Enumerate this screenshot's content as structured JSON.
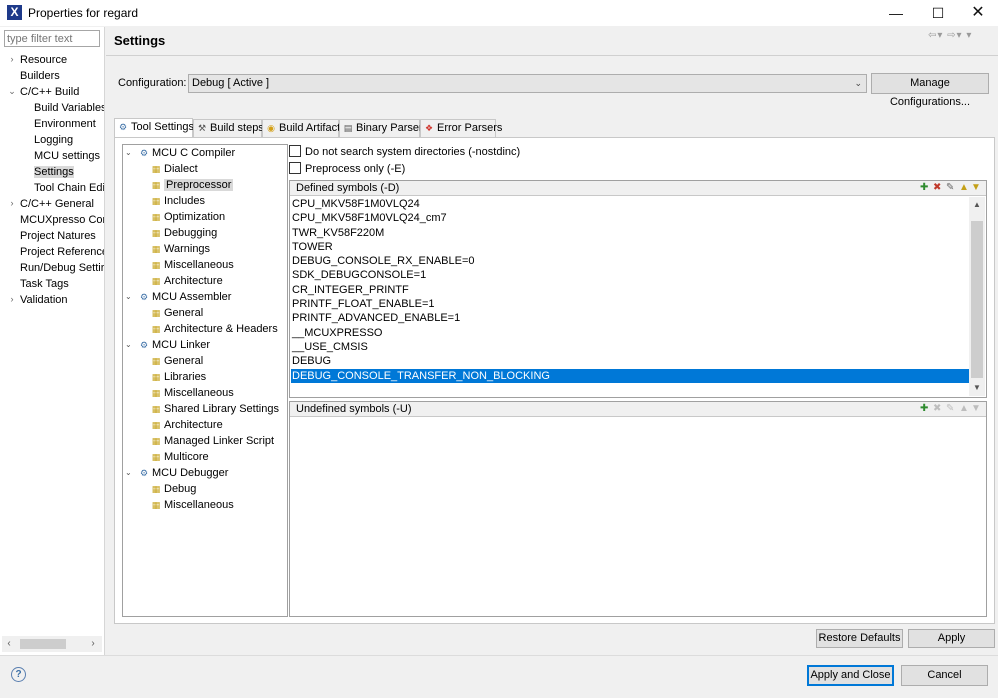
{
  "window": {
    "title": "Properties for regard"
  },
  "nav": {
    "filter_placeholder": "type filter text",
    "items": [
      {
        "label": "Resource",
        "arrow": "›"
      },
      {
        "label": "Builders"
      },
      {
        "label": "C/C++ Build",
        "arrow": "⌄"
      },
      {
        "label": "Build Variables"
      },
      {
        "label": "Environment"
      },
      {
        "label": "Logging"
      },
      {
        "label": "MCU settings"
      },
      {
        "label": "Settings",
        "selected": true
      },
      {
        "label": "Tool Chain Edi"
      },
      {
        "label": "C/C++ General",
        "arrow": "›"
      },
      {
        "label": "MCUXpresso Cor"
      },
      {
        "label": "Project Natures"
      },
      {
        "label": "Project Reference"
      },
      {
        "label": "Run/Debug Settir"
      },
      {
        "label": "Task Tags"
      },
      {
        "label": "Validation",
        "arrow": "›"
      }
    ]
  },
  "page": {
    "title": "Settings"
  },
  "configuration": {
    "label": "Configuration:",
    "value": "Debug  [ Active ]",
    "manage_label": "Manage Configurations..."
  },
  "tabs": [
    {
      "label": "Tool Settings",
      "icon": "gear-icon"
    },
    {
      "label": "Build steps",
      "icon": "wrench-icon"
    },
    {
      "label": "Build Artifact",
      "icon": "artifact-icon"
    },
    {
      "label": "Binary Parsers",
      "icon": "binary-icon"
    },
    {
      "label": "Error Parsers",
      "icon": "error-icon"
    }
  ],
  "tool_tree": {
    "mcu_c_compiler": {
      "label": "MCU C Compiler",
      "children": [
        "Dialect",
        "Preprocessor",
        "Includes",
        "Optimization",
        "Debugging",
        "Warnings",
        "Miscellaneous",
        "Architecture"
      ]
    },
    "mcu_assembler": {
      "label": "MCU Assembler",
      "children": [
        "General",
        "Architecture & Headers"
      ]
    },
    "mcu_linker": {
      "label": "MCU Linker",
      "children": [
        "General",
        "Libraries",
        "Miscellaneous",
        "Shared Library Settings",
        "Architecture",
        "Managed Linker Script",
        "Multicore"
      ]
    },
    "mcu_debugger": {
      "label": "MCU Debugger",
      "children": [
        "Debug",
        "Miscellaneous"
      ]
    },
    "selected": "Preprocessor"
  },
  "preprocessor": {
    "nostdinc_label": "Do not search system directories (-nostdinc)",
    "nostdinc_checked": false,
    "preprocess_only_label": "Preprocess only (-E)",
    "preprocess_only_checked": false,
    "defined_title": "Defined symbols (-D)",
    "defined_symbols": [
      "CPU_MKV58F1M0VLQ24",
      "CPU_MKV58F1M0VLQ24_cm7",
      "TWR_KV58F220M",
      "TOWER",
      "DEBUG_CONSOLE_RX_ENABLE=0",
      "SDK_DEBUGCONSOLE=1",
      "CR_INTEGER_PRINTF",
      "PRINTF_FLOAT_ENABLE=1",
      "PRINTF_ADVANCED_ENABLE=1",
      "__MCUXPRESSO",
      "__USE_CMSIS",
      "DEBUG",
      "DEBUG_CONSOLE_TRANSFER_NON_BLOCKING"
    ],
    "selected_symbol": "DEBUG_CONSOLE_TRANSFER_NON_BLOCKING",
    "undefined_title": "Undefined symbols (-U)",
    "undefined_symbols": []
  },
  "buttons": {
    "restore_defaults": "Restore Defaults",
    "apply": "Apply",
    "apply_and_close": "Apply and Close",
    "cancel": "Cancel"
  },
  "colors": {
    "selection": "#0078d7",
    "accent": "#0078d7"
  }
}
